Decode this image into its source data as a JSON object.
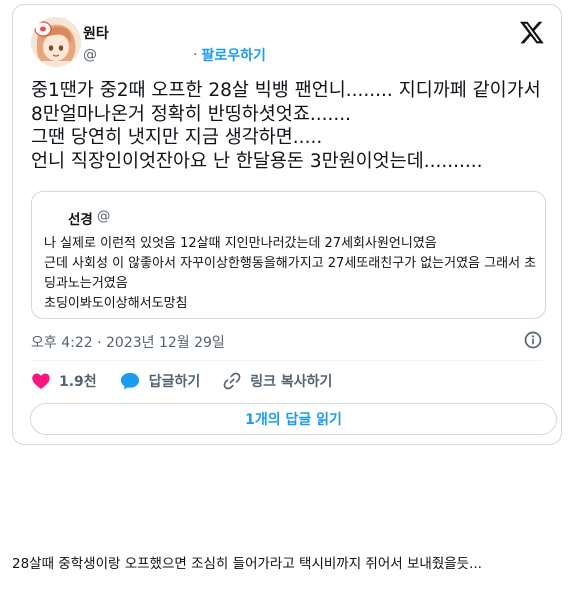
{
  "tweet": {
    "author_name": "원타",
    "handle": "@",
    "separator": "·",
    "follow_label": "팔로우하기",
    "text": "중1땐가 중2때 오프한 28살 빅뱅 팬언니........ 지디까페 같이가서 8만얼마나온거 정확히 반띵하셧엇죠.......\n그땐 당연히 냇지만 지금 생각하면.....\n언니 직장인이엇잔아요 난 한달용돈 3만원이엇는데..........",
    "quote": {
      "author_name": "선경",
      "handle": "@",
      "text": "나 실제로 이런적 있엇음 12살때 지인만나러갔는데 27세회사원언니였음\n근데 사회성 이 않좋아서 자꾸이상한행동을해가지고 27세또래친구가 없는거였음 그래서 초딩과노는거였음\n초딩이봐도이상해서도망침"
    },
    "timestamp": "오후 4:22 · 2023년 12월 29일",
    "likes": "1.9천",
    "reply_label": "답글하기",
    "copy_link_label": "링크 복사하기",
    "read_replies_label": "1개의 답글 읽기",
    "icons": {
      "like": "heart-icon",
      "reply": "speech-bubble-icon",
      "link": "link-icon",
      "info": "info-icon",
      "logo": "x-logo-icon"
    },
    "colors": {
      "accent": "#1d9bf0",
      "like": "#f91880",
      "muted": "#536471",
      "border": "#cfd9de"
    }
  },
  "caption": "28살때 중학생이랑 오프했으면 조심히 들어가라고 택시비까지 쥐어서 보내줬을듯..."
}
